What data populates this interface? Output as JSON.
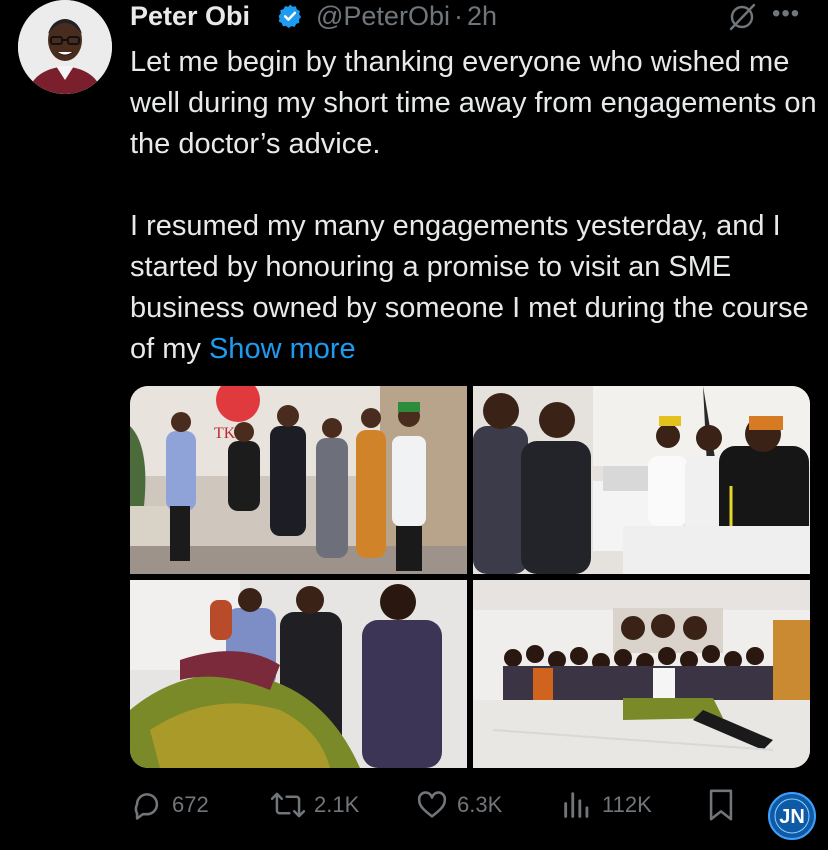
{
  "author": {
    "name": "Peter Obi",
    "handle": "@PeterObi",
    "separator": "·",
    "time": "2h",
    "verified_color": "#1d9bf0",
    "avatar_icon": "profile-photo"
  },
  "tweet": {
    "paragraph1": "Let me begin by thanking everyone who wished me well during my short time away from engagements on the doctor’s advice.",
    "paragraph2": "I resumed my many engagements yesterday, and I started by honouring a promise to visit an SME business owned by someone I met during the course of my ",
    "show_more": "Show more"
  },
  "photo_sign": "TKG",
  "actions": {
    "replies": "672",
    "reposts": "2.1K",
    "likes": "6.3K",
    "views": "112K"
  },
  "watermark": "JN"
}
